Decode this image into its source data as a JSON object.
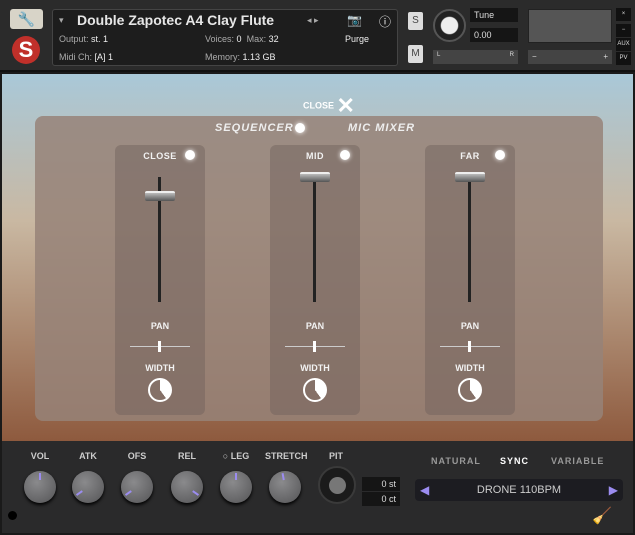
{
  "header": {
    "instrument": "Double Zapotec A4 Clay Flute",
    "output_label": "Output:",
    "output_value": "st. 1",
    "midi_label": "Midi Ch:",
    "midi_value": "[A] 1",
    "voices_label": "Voices:",
    "voices_value": "0",
    "max_label": "Max:",
    "max_value": "32",
    "memory_label": "Memory:",
    "memory_value": "1.13 GB",
    "purge": "Purge",
    "solo": "S",
    "mute": "M",
    "tune_label": "Tune",
    "tune_value": "0.00",
    "pan_l": "L",
    "pan_r": "R",
    "vol_minus": "−",
    "vol_plus": "+",
    "close": "×",
    "minimize": "−",
    "aux": "AUX",
    "pv": "PV"
  },
  "mixer": {
    "close_label": "CLOSE",
    "tabs": [
      {
        "label": "SEQUENCER",
        "active": false
      },
      {
        "label": "MIC MIXER",
        "active": true
      }
    ],
    "channels": [
      {
        "name": "CLOSE",
        "level": 0.75,
        "pan": 0,
        "width_label": "WIDTH",
        "pan_label": "PAN"
      },
      {
        "name": "MID",
        "level": 1.0,
        "pan": 0,
        "width_label": "WIDTH",
        "pan_label": "PAN"
      },
      {
        "name": "FAR",
        "level": 1.0,
        "pan": 0,
        "width_label": "WIDTH",
        "pan_label": "PAN"
      }
    ]
  },
  "controls": {
    "knobs": [
      {
        "label": "VOL",
        "angle": 0
      },
      {
        "label": "ATK",
        "angle": -125
      },
      {
        "label": "OFS",
        "angle": -125
      },
      {
        "label": "REL",
        "angle": 125
      },
      {
        "label": "LEG",
        "angle": 0
      },
      {
        "label": "STRETCH",
        "angle": -10
      }
    ],
    "pit_label": "PIT",
    "semitones": "0 st",
    "cents": "0 ct",
    "modes": [
      "NATURAL",
      "SYNC",
      "VARIABLE"
    ],
    "active_mode": "SYNC",
    "preset": "DRONE 110BPM",
    "accent": "#9b8cf0"
  }
}
